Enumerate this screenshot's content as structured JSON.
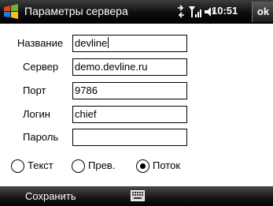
{
  "titlebar": {
    "title": "Параметры сервера",
    "time": "10:51",
    "ok_label": "ok"
  },
  "form": {
    "name_label": "Название",
    "name_value": "devline",
    "server_label": "Сервер",
    "server_value": "demo.devline.ru",
    "port_label": "Порт",
    "port_value": "9786",
    "login_label": "Логин",
    "login_value": "chief",
    "password_label": "Пароль",
    "password_value": ""
  },
  "mode": {
    "options": [
      "Текст",
      "Прев.",
      "Поток"
    ],
    "selected": "Поток"
  },
  "softkeys": {
    "left_label": "Сохранить"
  },
  "icons": {
    "start": "windows-flag-icon",
    "connectivity": "connectivity-icon",
    "signal": "signal-icon",
    "volume": "volume-icon",
    "keyboard": "keyboard-icon"
  }
}
